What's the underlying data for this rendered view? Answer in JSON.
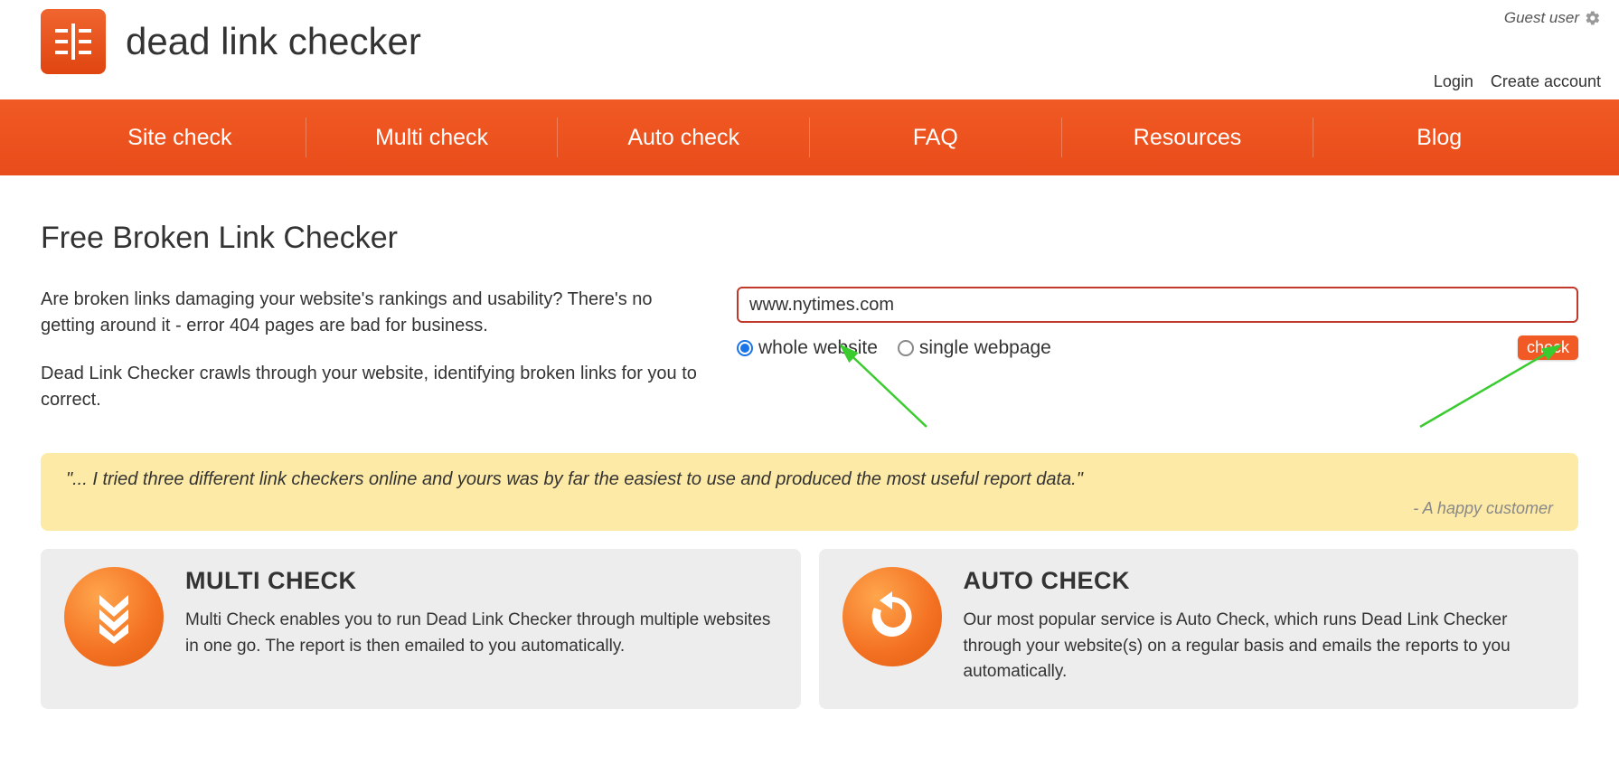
{
  "header": {
    "site_title": "dead link checker",
    "guest_label": "Guest user",
    "login_label": "Login",
    "create_account_label": "Create account"
  },
  "nav": {
    "items": [
      "Site check",
      "Multi check",
      "Auto check",
      "FAQ",
      "Resources",
      "Blog"
    ]
  },
  "main": {
    "heading": "Free Broken Link Checker",
    "intro_p1": "Are broken links damaging your website's rankings and usability? There's no getting around it - error 404 pages are bad for business.",
    "intro_p2": "Dead Link Checker crawls through your website, identifying broken links for you to correct."
  },
  "form": {
    "url_value": "www.nytimes.com",
    "radio_whole": "whole website",
    "radio_single": "single webpage",
    "radio_selected": "whole",
    "check_label": "check"
  },
  "quote": {
    "text": "\"... I tried three different link checkers online and yours was by far the easiest to use and produced the most useful report data.\"",
    "attribution": "- A happy customer"
  },
  "features": {
    "multi": {
      "title": "MULTI CHECK",
      "desc": "Multi Check enables you to run Dead Link Checker through multiple websites in one go. The report is then emailed to you automatically."
    },
    "auto": {
      "title": "AUTO CHECK",
      "desc": "Our most popular service is Auto Check, which runs Dead Link Checker through your website(s) on a regular basis and emails the reports to you automatically."
    }
  }
}
